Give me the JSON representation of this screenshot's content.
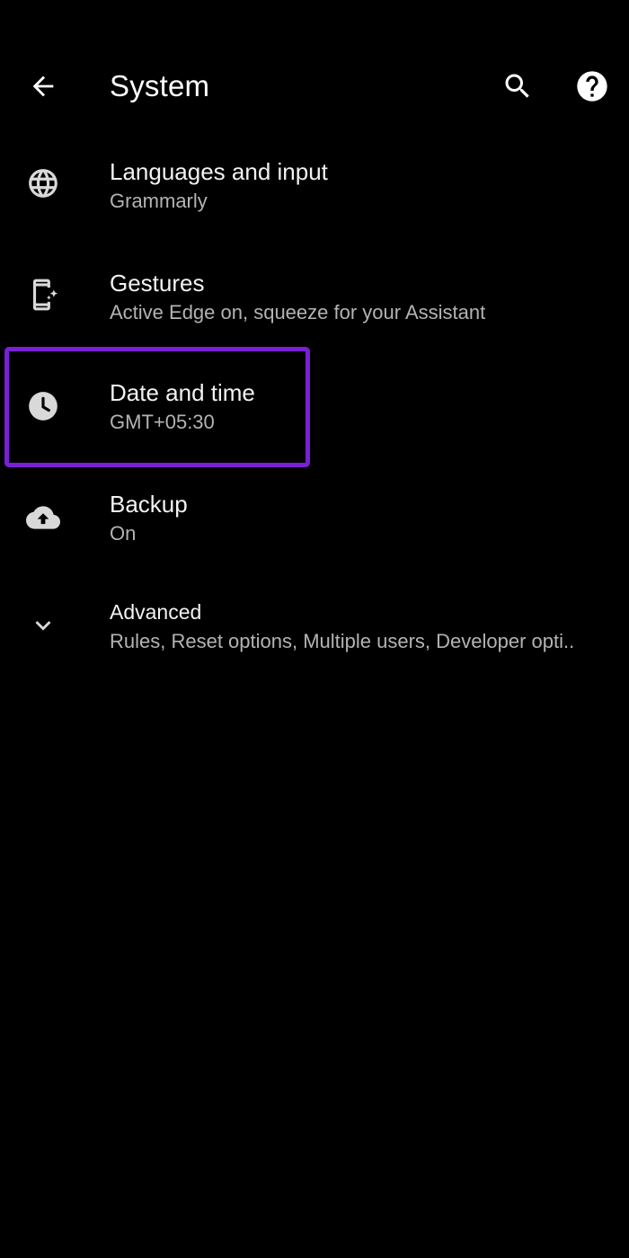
{
  "app_bar": {
    "title": "System",
    "back_icon": "arrow-back-icon",
    "search_icon": "search-icon",
    "help_icon": "help-circle-icon"
  },
  "settings": [
    {
      "icon": "globe-icon",
      "title": "Languages and input",
      "subtitle": "Grammarly"
    },
    {
      "icon": "phone-gesture-icon",
      "title": "Gestures",
      "subtitle": "Active Edge on, squeeze for your Assistant"
    },
    {
      "icon": "clock-icon",
      "title": "Date and time",
      "subtitle": "GMT+05:30"
    },
    {
      "icon": "cloud-upload-icon",
      "title": "Backup",
      "subtitle": "On"
    },
    {
      "icon": "chevron-down-icon",
      "title": "Advanced",
      "subtitle": "Rules, Reset options, Multiple users, Developer opti.."
    }
  ],
  "colors": {
    "background": "#000000",
    "text_primary": "#f2f2f2",
    "text_secondary": "#b3b3b3",
    "icon": "#d9d9d9",
    "highlight": "#7a1fd6"
  }
}
